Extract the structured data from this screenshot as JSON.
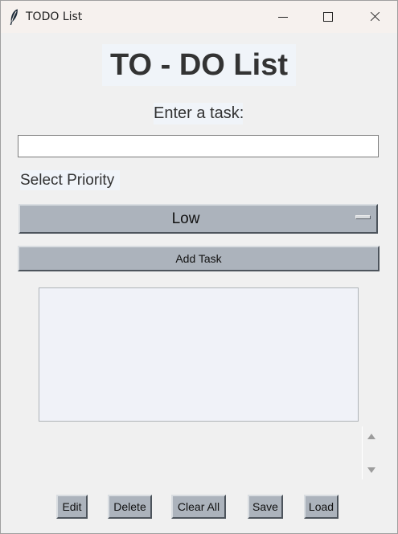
{
  "window": {
    "title": "TODO List",
    "icon": "feather-icon",
    "controls": [
      "minimize-icon",
      "maximize-icon",
      "close-icon"
    ]
  },
  "main": {
    "heading": "TO - DO List",
    "task_label": "Enter a task:",
    "task_input_value": "",
    "priority_label": "Select Priority",
    "priority_selected": "Low",
    "add_task_label": "Add Task",
    "task_list_items": []
  },
  "actions": {
    "edit": "Edit",
    "delete": "Delete",
    "clear_all": "Clear All",
    "save": "Save",
    "load": "Load"
  },
  "colors": {
    "window_background": "#f0f0f0",
    "button_background": "#acb3bc",
    "label_background": "#f0f4f9",
    "list_background": "#f0f2f8"
  }
}
